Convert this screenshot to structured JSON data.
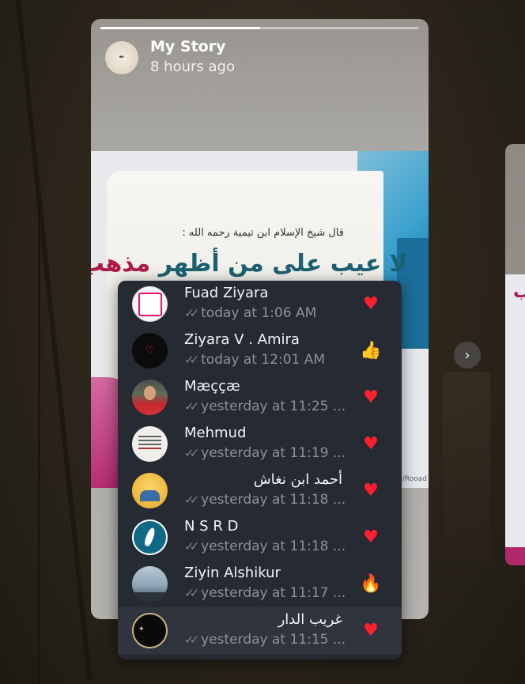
{
  "story": {
    "title": "My Story",
    "time": "8 hours ago",
    "progress": 0.5,
    "image": {
      "caption": "قال شيخ الإسلام ابن تيمية رحمه الله :",
      "headline_red": "مذهب",
      "headline_blue": "لا عيب على من أظهر",
      "url": "n/Rooad"
    }
  },
  "navigation": {
    "next_glyph": "›"
  },
  "viewers": [
    {
      "name": "Fuad Ziyara",
      "status": "today at 1:06 AM",
      "reaction": "heart",
      "reaction_glyph": "♥",
      "rtl": false,
      "avatar": "av-fuad"
    },
    {
      "name": "Ziyara V . Amira",
      "status": "today at 12:01 AM",
      "reaction": "like",
      "reaction_glyph": "👍",
      "rtl": false,
      "avatar": "av-amira"
    },
    {
      "name": "Mæççæ",
      "status": "yesterday at 11:25 ...",
      "reaction": "heart",
      "reaction_glyph": "♥",
      "rtl": false,
      "avatar": "av-maecc"
    },
    {
      "name": "Mehmud",
      "status": "yesterday at 11:19 ...",
      "reaction": "heart",
      "reaction_glyph": "♥",
      "rtl": false,
      "avatar": "av-mehmud"
    },
    {
      "name": "أحمد ابن نغاش",
      "status": "yesterday at 11:18 ...",
      "reaction": "heart",
      "reaction_glyph": "♥",
      "rtl": true,
      "avatar": "av-ahmed"
    },
    {
      "name": "N S R D",
      "status": "yesterday at 11:18 ...",
      "reaction": "heart",
      "reaction_glyph": "♥",
      "rtl": false,
      "avatar": "av-nsrd"
    },
    {
      "name": "Ziyin Alshikur",
      "status": "yesterday at 11:17 ...",
      "reaction": "fire",
      "reaction_glyph": "🔥",
      "rtl": false,
      "avatar": "av-ziyin"
    },
    {
      "name": "غريب الدار",
      "status": "yesterday at 11:15 ...",
      "reaction": "heart",
      "reaction_glyph": "♥",
      "rtl": true,
      "avatar": "av-ghareeb"
    }
  ],
  "check_glyph": "✓✓",
  "colors": {
    "panel": "#262a33",
    "panel_active": "#2f343e",
    "heart": "#ff1f2f",
    "text": "#f3f4f6",
    "muted": "#8b919b"
  }
}
